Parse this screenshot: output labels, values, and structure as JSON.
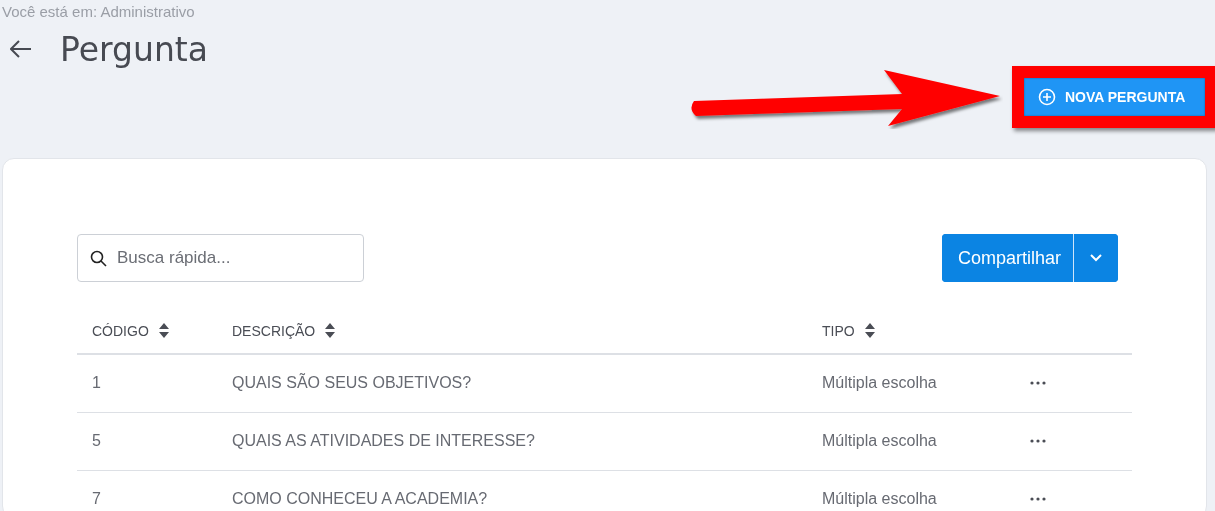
{
  "breadcrumb": "Você está em: Administrativo",
  "title": "Pergunta",
  "new_button": {
    "label": "NOVA PERGUNTA"
  },
  "search": {
    "placeholder": "Busca rápida..."
  },
  "share_button": {
    "label": "Compartilhar"
  },
  "table": {
    "columns": [
      {
        "label": "CÓDIGO",
        "sortable": true
      },
      {
        "label": "DESCRIÇÃO",
        "sortable": true
      },
      {
        "label": "TIPO",
        "sortable": true
      }
    ],
    "rows": [
      {
        "code": "1",
        "description": "QUAIS SÃO SEUS OBJETIVOS?",
        "type": "Múltipla escolha"
      },
      {
        "code": "5",
        "description": "QUAIS AS ATIVIDADES DE INTERESSE?",
        "type": "Múltipla escolha"
      },
      {
        "code": "7",
        "description": "COMO CONHECEU A ACADEMIA?",
        "type": "Múltipla escolha"
      }
    ]
  }
}
